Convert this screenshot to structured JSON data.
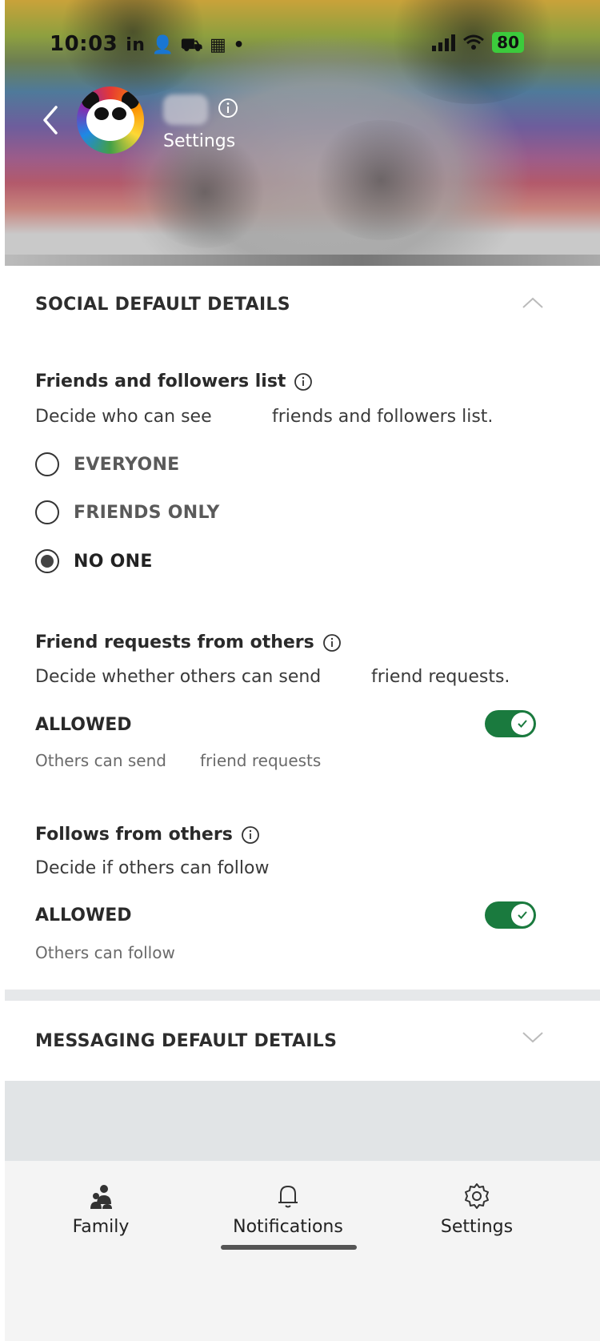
{
  "status_bar": {
    "time": "10:03",
    "notification_glyphs": "in 👤 ⛟ ▦ •",
    "battery": "80"
  },
  "header": {
    "subtitle": "Settings"
  },
  "social_section": {
    "title": "SOCIAL DEFAULT DETAILS",
    "friends_list": {
      "label": "Friends and followers list",
      "description_part1": "Decide who can see",
      "description_part2": "friends and followers list.",
      "options": [
        {
          "label": "EVERYONE",
          "selected": false
        },
        {
          "label": "FRIENDS ONLY",
          "selected": false
        },
        {
          "label": "NO ONE",
          "selected": true
        }
      ]
    },
    "friend_requests": {
      "label": "Friend requests from others",
      "description_part1": "Decide whether others can send",
      "description_part2": "friend requests.",
      "status": "ALLOWED",
      "toggle_on": true,
      "note_part1": "Others can send",
      "note_part2": "friend requests"
    },
    "follows": {
      "label": "Follows from others",
      "description": "Decide if others can follow",
      "status": "ALLOWED",
      "toggle_on": true,
      "note": "Others can follow"
    }
  },
  "messaging_section": {
    "title": "MESSAGING DEFAULT DETAILS"
  },
  "bottom_nav": {
    "items": [
      {
        "label": "Family",
        "icon": "family-icon"
      },
      {
        "label": "Notifications",
        "icon": "bell-icon"
      },
      {
        "label": "Settings",
        "icon": "gear-icon"
      }
    ]
  },
  "colors": {
    "toggle_on": "#1a7a3e",
    "text_primary": "#2a2a2a"
  }
}
